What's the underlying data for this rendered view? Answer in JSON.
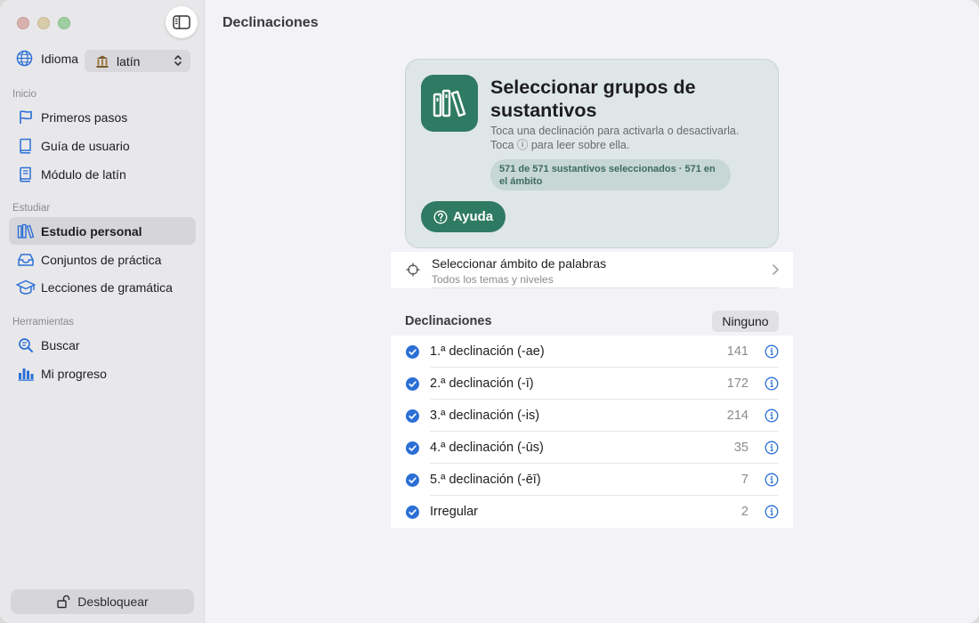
{
  "sidebar": {
    "language_label": "Idioma",
    "language_value": "latín",
    "sections": [
      {
        "title": "Inicio",
        "items": [
          "Primeros pasos",
          "Guía de usuario",
          "Módulo de latín"
        ]
      },
      {
        "title": "Estudiar",
        "items": [
          "Estudio personal",
          "Conjuntos de práctica",
          "Lecciones de gramática"
        ]
      },
      {
        "title": "Herramientas",
        "items": [
          "Buscar",
          "Mi progreso"
        ]
      }
    ],
    "active_item": "Estudio personal",
    "unlock_label": "Desbloquear"
  },
  "main": {
    "title": "Declinaciones",
    "hero": {
      "title": "Seleccionar grupos de sustantivos",
      "desc_line1": "Toca una declinación para activarla o desactivarla.",
      "desc_line2": "Toca ⓘ para leer sobre ella.",
      "pill": "571 de 571 sustantivos seleccionados · 571 en el ámbito",
      "help_label": "Ayuda"
    },
    "scope": {
      "title": "Seleccionar ámbito de palabras",
      "subtitle": "Todos los temas y niveles"
    },
    "declensions_header": "Declinaciones",
    "none_button": "Ninguno",
    "declensions": [
      {
        "name": "1.ª declinación (-ae)",
        "count": "141"
      },
      {
        "name": "2.ª declinación (-ī)",
        "count": "172"
      },
      {
        "name": "3.ª declinación (-is)",
        "count": "214"
      },
      {
        "name": "4.ª declinación (-ūs)",
        "count": "35"
      },
      {
        "name": "5.ª declinación (-ēī)",
        "count": "7"
      },
      {
        "name": "Irregular",
        "count": "2"
      }
    ]
  },
  "colors": {
    "accent_blue": "#2b6fd6",
    "hero_green": "#2f7a62",
    "sidebar_bg": "#e8e8ea",
    "content_bg": "#f2f2f7"
  }
}
